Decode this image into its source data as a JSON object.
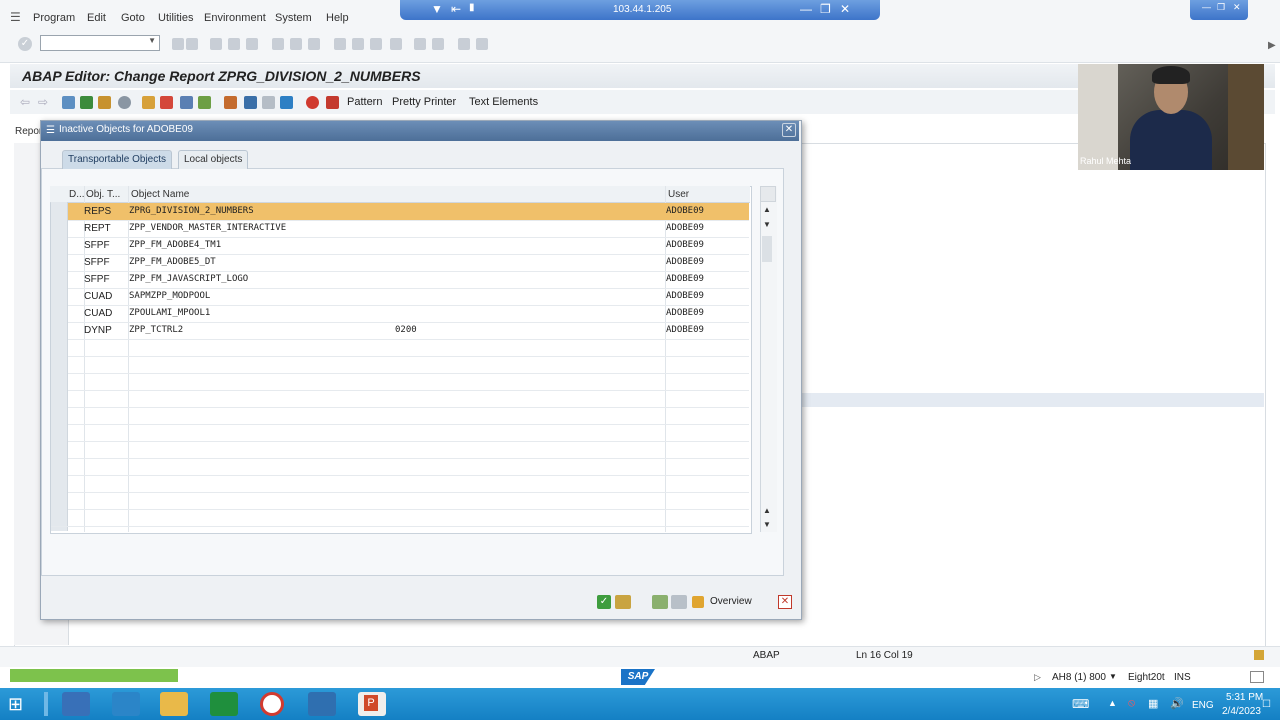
{
  "menu": {
    "items": [
      "Program",
      "Edit",
      "Goto",
      "Utilities",
      "Environment",
      "System",
      "Help"
    ]
  },
  "remote": {
    "ip": "103.44.1.205"
  },
  "window": {
    "title": "ABAP Editor: Change Report ZPRG_DIVISION_2_NUMBERS",
    "report_label": "Repor"
  },
  "toolbar2": {
    "pattern": "Pattern",
    "pretty_printer": "Pretty Printer",
    "text_elements": "Text Elements"
  },
  "dialog": {
    "title": "Inactive Objects for ADOBE09",
    "tabs": [
      "Transportable Objects",
      "Local objects"
    ],
    "columns": [
      "D...",
      "Obj. T...",
      "Object Name",
      "User"
    ],
    "rows": [
      {
        "type": "REPS",
        "name": "ZPRG_DIVISION_2_NUMBERS",
        "extra": "",
        "user": "ADOBE09",
        "selected": true
      },
      {
        "type": "REPT",
        "name": "ZPP_VENDOR_MASTER_INTERACTIVE",
        "extra": "",
        "user": "ADOBE09"
      },
      {
        "type": "SFPF",
        "name": "ZPP_FM_ADOBE4_TM1",
        "extra": "",
        "user": "ADOBE09"
      },
      {
        "type": "SFPF",
        "name": "ZPP_FM_ADOBE5_DT",
        "extra": "",
        "user": "ADOBE09"
      },
      {
        "type": "SFPF",
        "name": "ZPP_FM_JAVASCRIPT_LOGO",
        "extra": "",
        "user": "ADOBE09"
      },
      {
        "type": "CUAD",
        "name": "SAPMZPP_MODPOOL",
        "extra": "",
        "user": "ADOBE09"
      },
      {
        "type": "CUAD",
        "name": "ZPOULAMI_MPOOL1",
        "extra": "",
        "user": "ADOBE09"
      },
      {
        "type": "DYNP",
        "name": "ZPP_TCTRL2",
        "extra": "0200",
        "user": "ADOBE09"
      }
    ],
    "overview_label": "Overview"
  },
  "webcam": {
    "name": "Rahul Mehta"
  },
  "status": {
    "lang": "ABAP",
    "position": "Ln  16 Col  19",
    "system": "AH8 (1) 800",
    "server": "Eight20t",
    "mode": "INS"
  },
  "logo": {
    "text": "SAP"
  },
  "taskbar": {
    "lang": "ENG",
    "time": "5:31 PM",
    "date": "2/4/2023"
  },
  "colors": {
    "selected_row": "#f0c06a",
    "dialog_title": "#4d6f98",
    "taskbar": "#1480c4",
    "progress": "#7dc24c"
  }
}
